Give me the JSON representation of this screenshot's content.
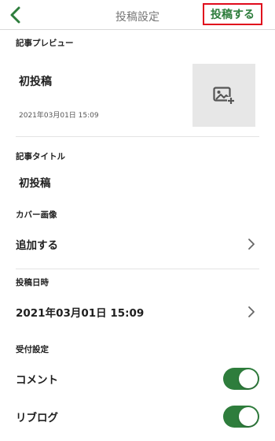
{
  "header": {
    "title": "投稿設定",
    "post_button": "投稿する"
  },
  "preview": {
    "label": "記事プレビュー",
    "title": "初投稿",
    "date": "2021年03月01日 15:09",
    "image_icon": "add-image-icon"
  },
  "article_title": {
    "label": "記事タイトル",
    "value": "初投稿"
  },
  "cover_image": {
    "label": "カバー画像",
    "action": "追加する"
  },
  "post_datetime": {
    "label": "投稿日時",
    "value": "2021年03月01日 15:09"
  },
  "reception": {
    "label": "受付設定",
    "comment_label": "コメント",
    "comment_enabled": true,
    "reblog_label": "リブログ",
    "reblog_enabled": true
  },
  "colors": {
    "accent_green": "#2e7d3c",
    "highlight_red": "#e00b1c"
  }
}
